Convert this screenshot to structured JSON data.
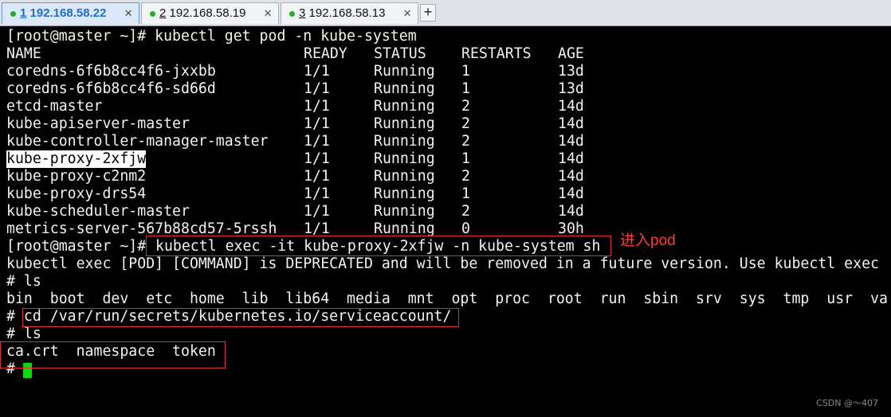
{
  "tabs": [
    {
      "num": "1",
      "host": "192.168.58.22",
      "close": "×",
      "active": true
    },
    {
      "num": "2",
      "host": "192.168.58.19",
      "close": "×",
      "active": false
    },
    {
      "num": "3",
      "host": "192.168.58.13",
      "close": "×",
      "active": false
    }
  ],
  "new_tab": "+",
  "terminal": {
    "cmd_get": "[root@master ~]# kubectl get pod -n kube-system",
    "headers": [
      "NAME",
      "READY",
      "STATUS",
      "RESTARTS",
      "AGE"
    ],
    "pods": [
      [
        "coredns-6f6b8cc4f6-jxxbb",
        "1/1",
        "Running",
        "1",
        "13d"
      ],
      [
        "coredns-6f6b8cc4f6-sd66d",
        "1/1",
        "Running",
        "1",
        "13d"
      ],
      [
        "etcd-master",
        "1/1",
        "Running",
        "2",
        "14d"
      ],
      [
        "kube-apiserver-master",
        "1/1",
        "Running",
        "2",
        "14d"
      ],
      [
        "kube-controller-manager-master",
        "1/1",
        "Running",
        "2",
        "14d"
      ],
      [
        "kube-proxy-2xfjw",
        "1/1",
        "Running",
        "1",
        "14d"
      ],
      [
        "kube-proxy-c2nm2",
        "1/1",
        "Running",
        "2",
        "14d"
      ],
      [
        "kube-proxy-drs54",
        "1/1",
        "Running",
        "1",
        "14d"
      ],
      [
        "kube-scheduler-master",
        "1/1",
        "Running",
        "2",
        "14d"
      ],
      [
        "metrics-server-567b88cd57-5rssh",
        "1/1",
        "Running",
        "0",
        "30h"
      ]
    ],
    "prompt": "[root@master ~]#",
    "cmd_exec": "kubectl exec -it kube-proxy-2xfjw -n kube-system sh",
    "warning": "kubectl exec [POD] [COMMAND] is DEPRECATED and will be removed in a future version. Use kubectl exec",
    "ls1": "# ls",
    "ls1_output": "bin  boot  dev  etc  home  lib  lib64  media  mnt  opt  proc  root  run  sbin  srv  sys  tmp  usr  va",
    "cd_cmd": "# cd /var/run/secrets/kubernetes.io/serviceaccount/",
    "ls2": "# ls",
    "ls2_output": "ca.crt  namespace  token",
    "last_prompt": "#"
  },
  "annotation": "进入pod",
  "watermark": "CSDN @～407",
  "colors": {
    "annotation": "#ff3b3b",
    "cursor": "#00e000",
    "active_tab": "#1e6fd0",
    "status_dot": "#22b022"
  }
}
